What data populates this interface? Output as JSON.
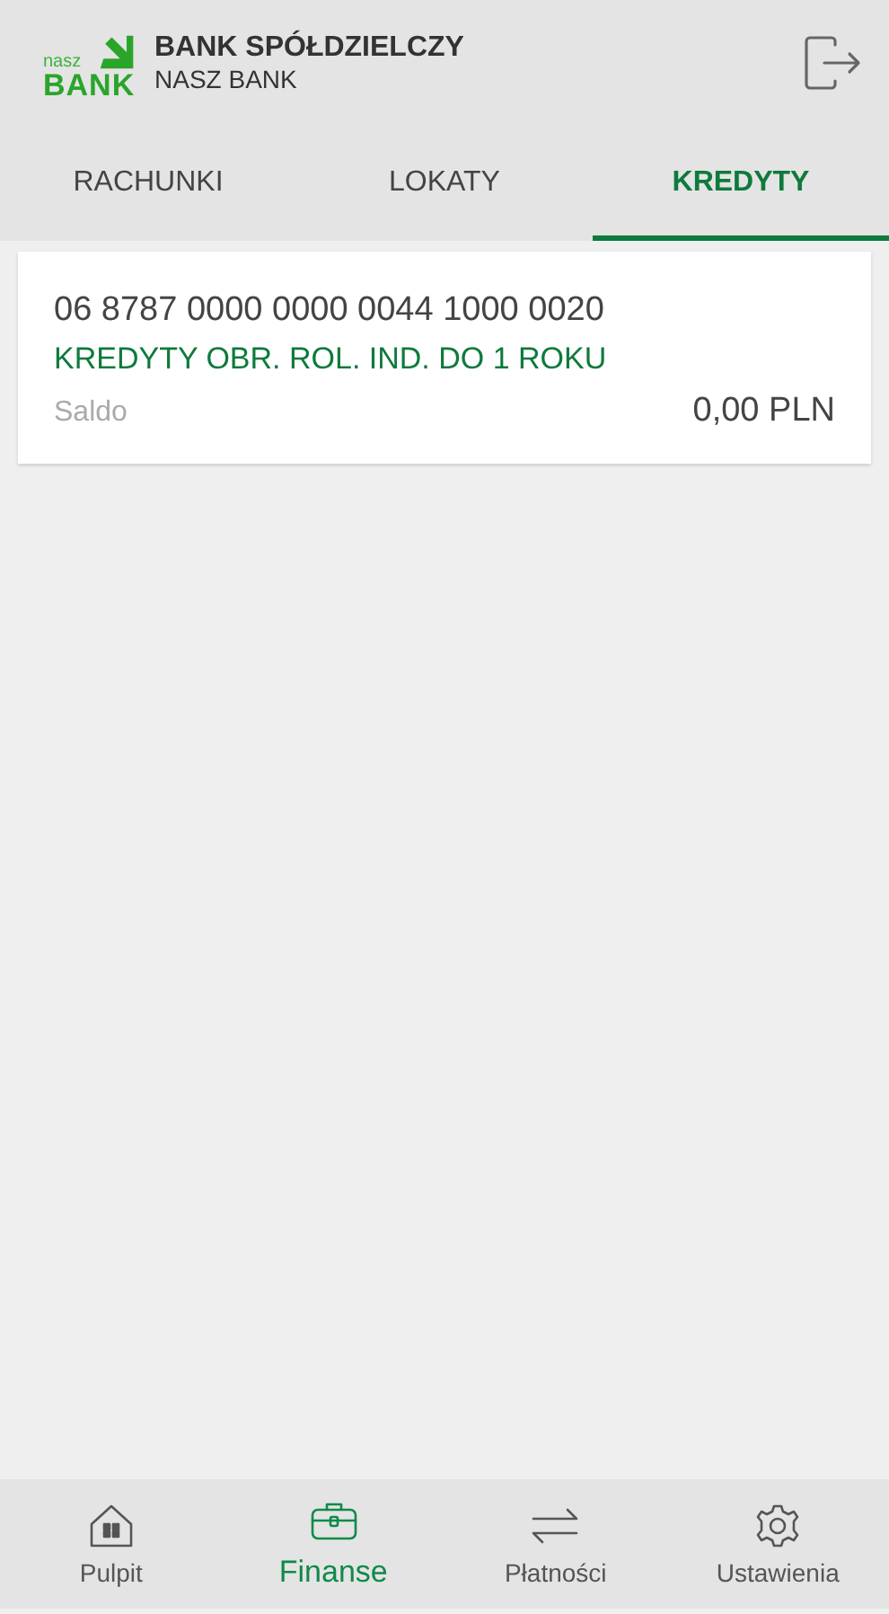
{
  "header": {
    "logo_small": "nasz",
    "logo_big": "BANK",
    "title": "BANK SPÓŁDZIELCZY",
    "subtitle": "NASZ BANK"
  },
  "tabs": [
    {
      "label": "RACHUNKI",
      "selected": false
    },
    {
      "label": "LOKATY",
      "selected": false
    },
    {
      "label": "KREDYTY",
      "selected": true
    }
  ],
  "accounts": [
    {
      "number": "06 8787 0000 0000 0044 1000 0020",
      "name": "KREDYTY OBR. ROL. IND. DO 1 ROKU",
      "balance_label": "Saldo",
      "balance": "0,00 PLN"
    }
  ],
  "bottom_nav": [
    {
      "label": "Pulpit",
      "selected": false
    },
    {
      "label": "Finanse",
      "selected": true
    },
    {
      "label": "Płatności",
      "selected": false
    },
    {
      "label": "Ustawienia",
      "selected": false
    }
  ]
}
